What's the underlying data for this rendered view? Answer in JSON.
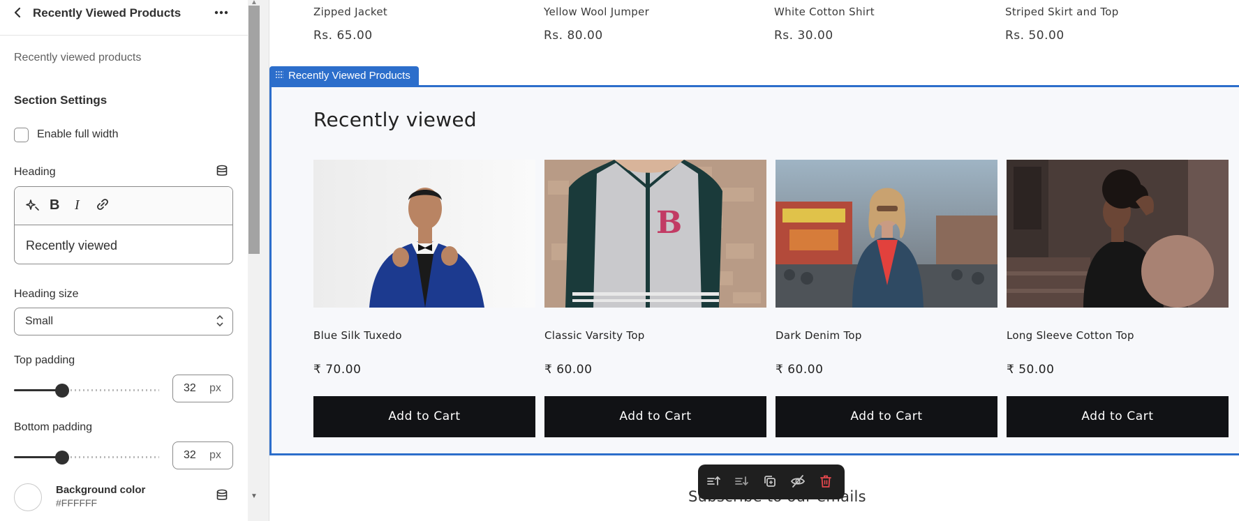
{
  "panel": {
    "title": "Recently Viewed Products",
    "subtitle": "Recently viewed products",
    "section_title": "Section Settings",
    "full_width_label": "Enable full width",
    "heading_label": "Heading",
    "heading_value": "Recently viewed",
    "heading_size_label": "Heading size",
    "heading_size_value": "Small",
    "top_padding_label": "Top padding",
    "top_padding_value": "32",
    "bottom_padding_label": "Bottom padding",
    "bottom_padding_value": "32",
    "unit": "px",
    "bg_color_label": "Background color",
    "bg_color_value": "#FFFFFF",
    "full_width_checked": false,
    "top_padding_slider_fraction": 0.33,
    "bottom_padding_slider_fraction": 0.33
  },
  "preview": {
    "top_products": [
      {
        "name": "Zipped Jacket",
        "price": "Rs. 65.00"
      },
      {
        "name": "Yellow Wool Jumper",
        "price": "Rs. 80.00"
      },
      {
        "name": "White Cotton Shirt",
        "price": "Rs. 30.00"
      },
      {
        "name": "Striped Skirt and Top",
        "price": "Rs. 50.00"
      }
    ],
    "section_tag": "Recently Viewed Products",
    "section_heading": "Recently viewed",
    "products": [
      {
        "name": "Blue Silk Tuxedo",
        "price": "₹ 70.00",
        "button": "Add to Cart"
      },
      {
        "name": "Classic Varsity Top",
        "price": "₹ 60.00",
        "button": "Add to Cart"
      },
      {
        "name": "Dark Denim Top",
        "price": "₹ 60.00",
        "button": "Add to Cart"
      },
      {
        "name": "Long Sleeve Cotton Top",
        "price": "₹ 50.00",
        "button": "Add to Cart"
      }
    ],
    "next_section_heading": "Subscribe to our emails"
  },
  "colors": {
    "accent": "#2c6ecb",
    "button": "#111215",
    "delete": "#e5484d"
  }
}
